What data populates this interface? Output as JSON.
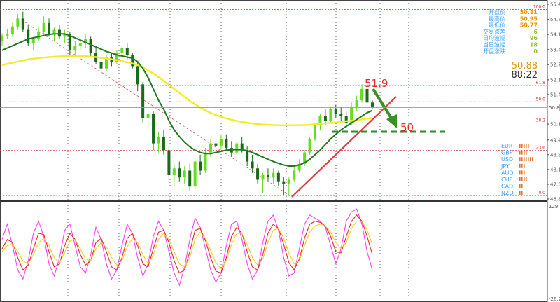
{
  "chart_data": [
    {
      "type": "candlestick",
      "ylim": [
        46.85,
        55.43
      ],
      "y_ticks": [
        "55.43",
        "54.76",
        "54.10",
        "53.43",
        "52.77",
        "52.10",
        "51.45",
        "50.78",
        "50.15",
        "49.45",
        "48.80",
        "48.15",
        "47.50",
        "46.85"
      ],
      "grid": true,
      "current_price": "50.88",
      "fib_levels": [
        {
          "label": "100.0",
          "value": 55.2
        },
        {
          "label": "61.8",
          "value": 51.85
        },
        {
          "label": "50.0",
          "value": 51.13
        },
        {
          "label": "38.2",
          "value": 50.2
        },
        {
          "label": "23.6",
          "value": 49.0
        },
        {
          "label": "0.0",
          "value": 47.0
        }
      ],
      "ohlc": [
        [
          53.8,
          54.15,
          53.6,
          54.05
        ],
        [
          54.05,
          54.35,
          53.9,
          54.1
        ],
        [
          54.1,
          54.6,
          54.0,
          54.45
        ],
        [
          54.45,
          55.0,
          54.3,
          54.8
        ],
        [
          54.8,
          55.1,
          54.2,
          54.3
        ],
        [
          54.3,
          54.5,
          53.6,
          53.7
        ],
        [
          53.7,
          54.0,
          53.4,
          53.9
        ],
        [
          53.9,
          54.4,
          53.8,
          54.2
        ],
        [
          54.2,
          54.9,
          54.1,
          54.6
        ],
        [
          54.6,
          54.8,
          54.0,
          54.1
        ],
        [
          54.1,
          54.4,
          53.8,
          54.3
        ],
        [
          54.3,
          54.5,
          53.9,
          54.0
        ],
        [
          54.0,
          54.3,
          53.7,
          54.1
        ],
        [
          54.1,
          54.2,
          53.2,
          53.4
        ],
        [
          53.4,
          53.8,
          53.2,
          53.6
        ],
        [
          53.6,
          53.9,
          53.4,
          53.7
        ],
        [
          53.7,
          54.1,
          53.5,
          53.9
        ],
        [
          53.9,
          54.0,
          53.1,
          53.3
        ],
        [
          53.3,
          53.5,
          52.8,
          52.9
        ],
        [
          52.9,
          53.1,
          52.4,
          52.6
        ],
        [
          52.6,
          53.2,
          52.5,
          53.1
        ],
        [
          53.1,
          53.3,
          52.7,
          52.9
        ],
        [
          52.9,
          53.4,
          52.8,
          53.3
        ],
        [
          53.3,
          53.6,
          53.1,
          53.5
        ],
        [
          53.5,
          53.7,
          53.0,
          53.2
        ],
        [
          53.2,
          53.3,
          52.6,
          52.7
        ],
        [
          52.7,
          52.9,
          51.6,
          51.9
        ],
        [
          51.9,
          52.0,
          50.2,
          50.4
        ],
        [
          50.4,
          50.8,
          49.9,
          50.6
        ],
        [
          50.6,
          50.7,
          49.0,
          49.3
        ],
        [
          49.3,
          49.8,
          48.9,
          49.6
        ],
        [
          49.6,
          49.9,
          48.8,
          49.0
        ],
        [
          49.0,
          49.2,
          47.6,
          47.9
        ],
        [
          47.9,
          48.4,
          47.4,
          48.2
        ],
        [
          48.2,
          48.5,
          47.6,
          47.8
        ],
        [
          47.8,
          48.3,
          47.5,
          48.1
        ],
        [
          48.1,
          48.4,
          47.2,
          47.4
        ],
        [
          47.4,
          48.7,
          47.3,
          48.5
        ],
        [
          48.5,
          48.8,
          47.9,
          48.1
        ],
        [
          48.1,
          49.1,
          48.0,
          48.9
        ],
        [
          48.9,
          49.5,
          48.7,
          49.3
        ],
        [
          49.3,
          49.6,
          48.9,
          49.2
        ],
        [
          49.2,
          49.7,
          49.0,
          49.5
        ],
        [
          49.5,
          49.7,
          49.0,
          49.1
        ],
        [
          49.1,
          49.4,
          48.7,
          48.9
        ],
        [
          48.9,
          49.4,
          48.8,
          49.3
        ],
        [
          49.3,
          49.6,
          48.9,
          49.0
        ],
        [
          49.0,
          49.2,
          48.3,
          48.5
        ],
        [
          48.5,
          48.8,
          48.0,
          48.2
        ],
        [
          48.2,
          48.4,
          47.5,
          47.7
        ],
        [
          47.7,
          48.0,
          47.1,
          47.9
        ],
        [
          47.9,
          48.2,
          47.6,
          47.8
        ],
        [
          47.8,
          48.2,
          47.5,
          48.0
        ],
        [
          48.0,
          48.1,
          47.4,
          47.6
        ],
        [
          47.6,
          47.8,
          47.0,
          47.5
        ],
        [
          47.5,
          47.8,
          47.0,
          47.7
        ],
        [
          47.7,
          48.3,
          47.6,
          48.1
        ],
        [
          48.1,
          48.6,
          48.0,
          48.4
        ],
        [
          48.4,
          49.0,
          48.3,
          48.9
        ],
        [
          48.9,
          49.6,
          48.8,
          49.5
        ],
        [
          49.5,
          50.2,
          49.4,
          50.1
        ],
        [
          50.1,
          50.6,
          49.9,
          50.5
        ],
        [
          50.5,
          50.8,
          50.1,
          50.3
        ],
        [
          50.3,
          50.9,
          50.2,
          50.8
        ],
        [
          50.8,
          51.0,
          50.4,
          50.6
        ],
        [
          50.6,
          50.9,
          50.3,
          50.5
        ],
        [
          50.5,
          50.7,
          50.0,
          50.2
        ],
        [
          50.2,
          51.1,
          50.1,
          50.9
        ],
        [
          50.9,
          51.4,
          50.7,
          51.2
        ],
        [
          51.2,
          51.9,
          51.1,
          51.7
        ],
        [
          51.7,
          51.8,
          51.0,
          51.1
        ],
        [
          51.1,
          51.2,
          50.8,
          50.88
        ]
      ],
      "ma_fast": [
        53.4,
        53.5,
        53.6,
        53.7,
        53.8,
        53.9,
        53.95,
        54.0,
        54.05,
        54.1,
        54.12,
        54.13,
        54.12,
        54.05,
        53.95,
        53.85,
        53.75,
        53.65,
        53.55,
        53.45,
        53.35,
        53.28,
        53.2,
        53.15,
        53.1,
        53.05,
        52.9,
        52.6,
        52.2,
        51.7,
        51.2,
        50.8,
        50.3,
        49.9,
        49.6,
        49.35,
        49.15,
        49.0,
        48.9,
        48.85,
        48.85,
        48.9,
        48.95,
        49.0,
        49.02,
        49.03,
        49.02,
        48.98,
        48.9,
        48.8,
        48.7,
        48.6,
        48.5,
        48.42,
        48.35,
        48.3,
        48.3,
        48.35,
        48.45,
        48.6,
        48.8,
        49.0,
        49.25,
        49.5,
        49.7,
        49.9,
        50.05,
        50.2,
        50.35,
        50.5,
        50.65,
        50.75
      ],
      "ma_slow": [
        52.75,
        52.8,
        52.85,
        52.9,
        52.95,
        53.0,
        53.03,
        53.05,
        53.08,
        53.1,
        53.12,
        53.13,
        53.14,
        53.15,
        53.15,
        53.15,
        53.14,
        53.12,
        53.1,
        53.07,
        53.04,
        53.0,
        52.96,
        52.92,
        52.87,
        52.82,
        52.75,
        52.65,
        52.52,
        52.38,
        52.22,
        52.05,
        51.88,
        51.7,
        51.52,
        51.35,
        51.18,
        51.02,
        50.88,
        50.75,
        50.64,
        50.55,
        50.47,
        50.4,
        50.34,
        50.29,
        50.25,
        50.21,
        50.18,
        50.15,
        50.13,
        50.12,
        50.11,
        50.1,
        50.1,
        50.1,
        50.1,
        50.1,
        50.11,
        50.12,
        50.14,
        50.16,
        50.18,
        50.2,
        50.22,
        50.25,
        50.28,
        50.3,
        50.33,
        50.36,
        50.39,
        50.42
      ]
    },
    {
      "type": "line",
      "ylim": [
        -26.75,
        129.36
      ],
      "y_ticks": [
        "129.36",
        "-26.75"
      ],
      "series": [
        {
          "color": "#ff40ff",
          "values": [
            70,
            95,
            60,
            20,
            5,
            35,
            80,
            100,
            75,
            30,
            10,
            40,
            85,
            95,
            60,
            25,
            15,
            45,
            90,
            70,
            30,
            5,
            20,
            60,
            95,
            80,
            40,
            10,
            30,
            75,
            100,
            85,
            50,
            15,
            -5,
            25,
            70,
            105,
            90,
            55,
            20,
            0,
            15,
            60,
            95,
            100,
            70,
            30,
            5,
            20,
            65,
            100,
            110,
            85,
            40,
            10,
            15,
            55,
            95,
            110,
            105,
            100,
            90,
            60,
            30,
            55,
            100,
            115,
            120,
            95,
            50,
            20
          ]
        },
        {
          "color": "#e52929",
          "values": [
            55,
            70,
            65,
            40,
            20,
            28,
            55,
            80,
            78,
            50,
            25,
            30,
            60,
            80,
            70,
            45,
            28,
            35,
            65,
            72,
            50,
            25,
            20,
            40,
            72,
            80,
            60,
            30,
            25,
            55,
            82,
            85,
            65,
            35,
            15,
            20,
            50,
            85,
            88,
            68,
            40,
            18,
            15,
            40,
            75,
            90,
            80,
            50,
            25,
            20,
            45,
            80,
            95,
            88,
            62,
            32,
            20,
            38,
            72,
            95,
            100,
            98,
            92,
            75,
            50,
            48,
            75,
            100,
            110,
            100,
            75,
            45
          ]
        },
        {
          "color": "#f0d020",
          "values": [
            50,
            60,
            62,
            50,
            35,
            30,
            45,
            65,
            72,
            60,
            40,
            32,
            48,
            68,
            70,
            55,
            38,
            35,
            55,
            65,
            58,
            40,
            28,
            35,
            58,
            72,
            65,
            45,
            30,
            45,
            70,
            80,
            70,
            50,
            30,
            25,
            40,
            70,
            82,
            72,
            52,
            32,
            22,
            35,
            62,
            80,
            80,
            62,
            40,
            28,
            38,
            65,
            85,
            88,
            72,
            48,
            30,
            35,
            60,
            82,
            92,
            95,
            92,
            82,
            65,
            55,
            65,
            88,
            100,
            100,
            85,
            62
          ]
        }
      ]
    }
  ],
  "info_panel": {
    "rows": [
      {
        "label": "开盘价",
        "value": "50.81",
        "color": "#e69500"
      },
      {
        "label": "最高价",
        "value": "50.95",
        "color": "#e69500"
      },
      {
        "label": "最低价",
        "value": "50.77",
        "color": "#e69500"
      },
      {
        "label": "交易点差",
        "value": "6",
        "color": "#8ac43a"
      },
      {
        "label": "日均波幅",
        "value": "96",
        "color": "#8ac43a"
      },
      {
        "label": "当日波幅",
        "value": "18",
        "color": "#8ac43a"
      },
      {
        "label": "开盘涨跌",
        "value": "0",
        "color": "#8ac43a"
      }
    ],
    "price": "50.88",
    "countdown": "88:22"
  },
  "currency_strength": [
    {
      "label": "EUR",
      "bars": 5,
      "color": "#e8742a"
    },
    {
      "label": "GBP",
      "bars": 4,
      "color": "#e8742a"
    },
    {
      "label": "USD",
      "bars": 7,
      "color": "#e8742a"
    },
    {
      "label": "JPY",
      "bars": 3,
      "color": "#e8742a"
    },
    {
      "label": "AUD",
      "bars": 3,
      "color": "#e8742a"
    },
    {
      "label": "CHF",
      "bars": 4,
      "color": "#e8742a"
    },
    {
      "label": "CAD",
      "bars": 2,
      "color": "#e8742a"
    },
    {
      "label": "NZD",
      "bars": 2,
      "color": "#e8742a"
    }
  ],
  "annotations": {
    "high_label": "51.9",
    "target_label": "50"
  },
  "colors": {
    "bull": "#66dd22",
    "bear": "#1a6a1a",
    "ma_fast": "#1f7a1f",
    "ma_slow": "#f2ec2a",
    "fib": "#d94a4a",
    "trendline": "#e23a3a",
    "grid": "#666666"
  }
}
